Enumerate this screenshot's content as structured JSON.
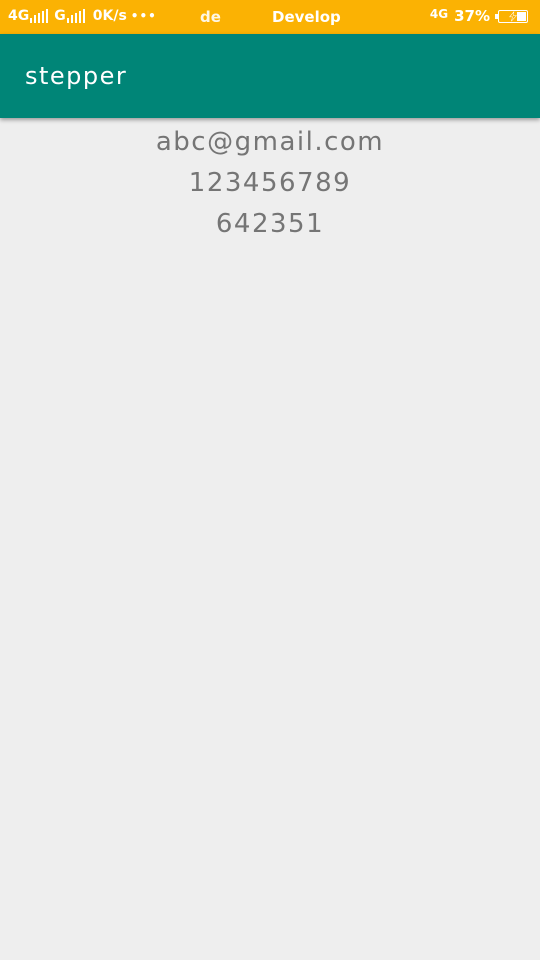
{
  "status_bar": {
    "sim1_label": "4G",
    "sim2_label": "G",
    "net_speed": "0K/s",
    "overflow_dots": "•••",
    "ticker_left": "de",
    "ticker_right": "Develop",
    "network_type": "4G",
    "battery_percent": "37%",
    "battery_level": 0.37,
    "background_color": "#fbb203"
  },
  "app_bar": {
    "title": "stepper",
    "background_color": "#008577"
  },
  "content": {
    "email": "abc@gmail.com",
    "phone": "123456789",
    "code": "642351",
    "text_color": "#757575"
  },
  "page": {
    "background_color": "#eeeeee"
  }
}
